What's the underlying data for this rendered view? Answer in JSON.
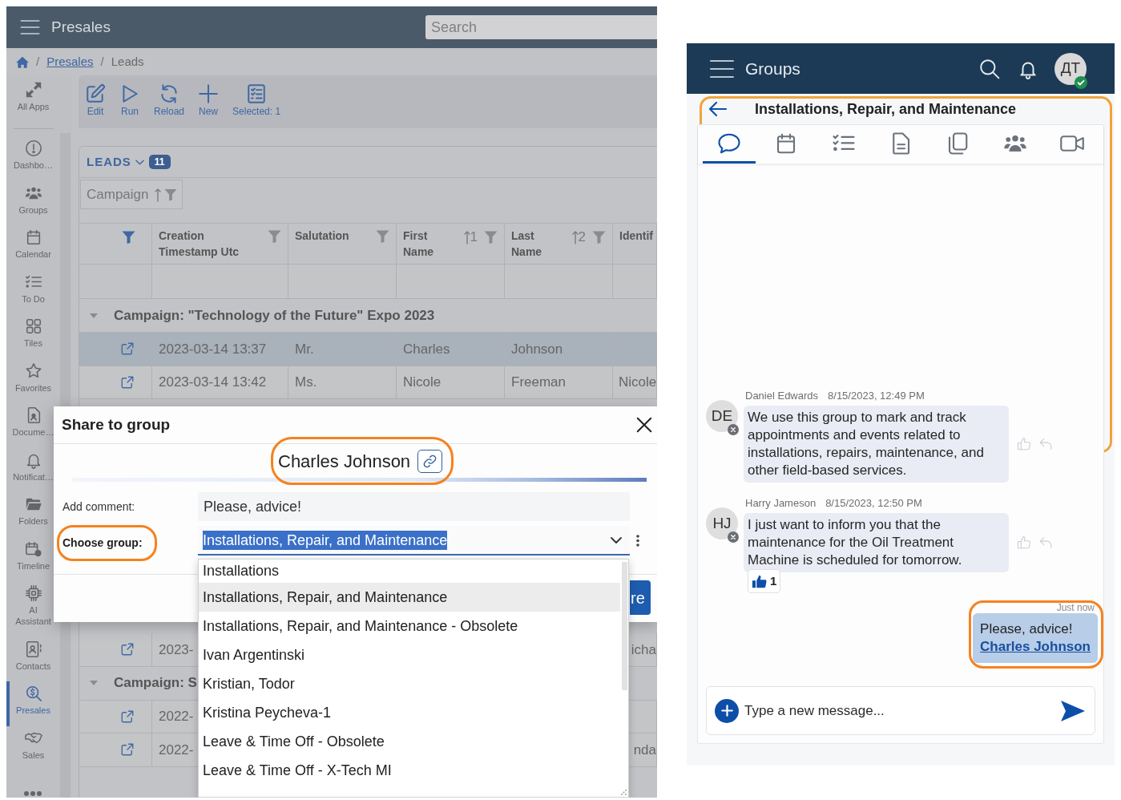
{
  "presales_app": {
    "header": {
      "title": "Presales",
      "search": {
        "placeholder": "Search"
      }
    },
    "breadcrumb": [
      {
        "kind": "home"
      },
      {
        "kind": "separator",
        "label": "/"
      },
      {
        "kind": "link",
        "label": "Presales"
      },
      {
        "kind": "separator",
        "label": "/"
      },
      {
        "kind": "current",
        "label": "Leads"
      }
    ],
    "sidebar": {
      "items": [
        {
          "label": "All Apps",
          "selected": false
        },
        {
          "label": "Dashbo…",
          "selected": false
        },
        {
          "label": "Groups",
          "selected": false
        },
        {
          "label": "Calendar",
          "selected": false
        },
        {
          "label": "To Do",
          "selected": false
        },
        {
          "label": "Tiles",
          "selected": false
        },
        {
          "label": "Favorites",
          "selected": false
        },
        {
          "label": "Docume…",
          "selected": false
        },
        {
          "label": "Notificat…",
          "selected": false
        },
        {
          "label": "Folders",
          "selected": false
        },
        {
          "label": "Timeline",
          "selected": false
        },
        {
          "label": "AI Assistant",
          "selected": false
        },
        {
          "label": "Contacts",
          "selected": false
        },
        {
          "label": "Presales",
          "selected": true
        },
        {
          "label": "Sales",
          "selected": false
        }
      ]
    },
    "toolbar": [
      {
        "label": "Edit"
      },
      {
        "label": "Run"
      },
      {
        "label": "Reload"
      },
      {
        "label": "New"
      },
      {
        "label": "Selected: 1"
      }
    ],
    "leads": {
      "title": "LEADS",
      "count": "11",
      "grouping": {
        "label": "Campaign"
      },
      "table": {
        "columns": [
          {
            "filtered": true
          },
          {
            "label": "Creation Timestamp Utc",
            "filtered": false
          },
          {
            "label": "Salutation",
            "filtered": false
          },
          {
            "label": "First Name",
            "sort_order": "1",
            "filtered": false
          },
          {
            "label": "Last Name",
            "sort_order": "2",
            "filtered": false
          },
          {
            "label": "Identif"
          }
        ],
        "rows": [
          {
            "kind": "group",
            "label": "Campaign: \"Technology of the Future\" Expo 2023",
            "expanded": true
          },
          {
            "kind": "record",
            "selected": true,
            "cells": [
              "2023-03-14 13:37",
              "Mr.",
              "Charles",
              "Johnson",
              null
            ]
          },
          {
            "kind": "record",
            "selected": false,
            "cells": [
              "2023-03-14 13:42",
              "Ms.",
              "Nicole",
              "Freeman",
              "Nicole"
            ]
          }
        ],
        "rows_below_dialog": [
          {
            "kind": "record",
            "selected": false,
            "cells": [
              "2023-",
              null,
              null,
              null,
              "icha"
            ]
          },
          {
            "kind": "group",
            "label": "Campaign: S",
            "expanded": true
          },
          {
            "kind": "record",
            "selected": false,
            "cells": [
              "2022-",
              null,
              null,
              null,
              null
            ]
          },
          {
            "kind": "record",
            "selected": false,
            "cells": [
              "2022-",
              null,
              null,
              null,
              "nda"
            ]
          }
        ]
      }
    }
  },
  "share_dialog": {
    "title": "Share to group",
    "record": {
      "name": "Charles Johnson",
      "highlighted": true
    },
    "comment": {
      "label": "Add comment:",
      "value": "Please, advice!"
    },
    "group": {
      "label": "Choose group:",
      "highlighted": true,
      "value": "Installations, Repair, and Maintenance",
      "options": [
        {
          "label": "Installations",
          "selected": false
        },
        {
          "label": "Installations, Repair, and Maintenance",
          "selected": true
        },
        {
          "label": "Installations, Repair, and Maintenance - Obsolete",
          "selected": false
        },
        {
          "label": "Ivan Argentinski",
          "selected": false
        },
        {
          "label": "Kristian, Todor",
          "selected": false
        },
        {
          "label": "Kristina Peycheva-1",
          "selected": false
        },
        {
          "label": "Leave & Time Off - Obsolete",
          "selected": false
        },
        {
          "label": "Leave & Time Off - X-Tech MI",
          "selected": false
        }
      ]
    },
    "primary_button": {
      "label": "re"
    }
  },
  "groups_app": {
    "header": {
      "title": "Groups",
      "avatar": {
        "initials": "ДТ",
        "online": true
      }
    },
    "group_header": {
      "title": "Installations, Repair, and Maintenance",
      "highlighted": true
    },
    "tabs": [
      {
        "selected": true
      },
      {
        "selected": false
      },
      {
        "selected": false
      },
      {
        "selected": false
      },
      {
        "selected": false
      },
      {
        "selected": false
      },
      {
        "selected": false
      }
    ],
    "messages": [
      {
        "kind": "incoming",
        "author": {
          "name": "Daniel Edwards",
          "initials": "DE",
          "online": false
        },
        "time": "8/15/2023, 12:49 PM",
        "text": "We use this group to mark and track appointments and events related to installations, repairs, maintenance, and other field-based services."
      },
      {
        "kind": "incoming",
        "author": {
          "name": "Harry Jameson",
          "initials": "HJ",
          "online": false
        },
        "time": "8/15/2023, 12:50 PM",
        "text": "I just want to inform you that the maintenance for the Oil Treatment Machine is scheduled for tomorrow.",
        "reactions": [
          {
            "count": "1"
          }
        ]
      },
      {
        "kind": "outgoing",
        "time": "Just now",
        "text": "Please, advice!",
        "link": "Charles Johnson",
        "highlighted": true
      }
    ],
    "composer": {
      "placeholder": "Type a new message..."
    }
  }
}
